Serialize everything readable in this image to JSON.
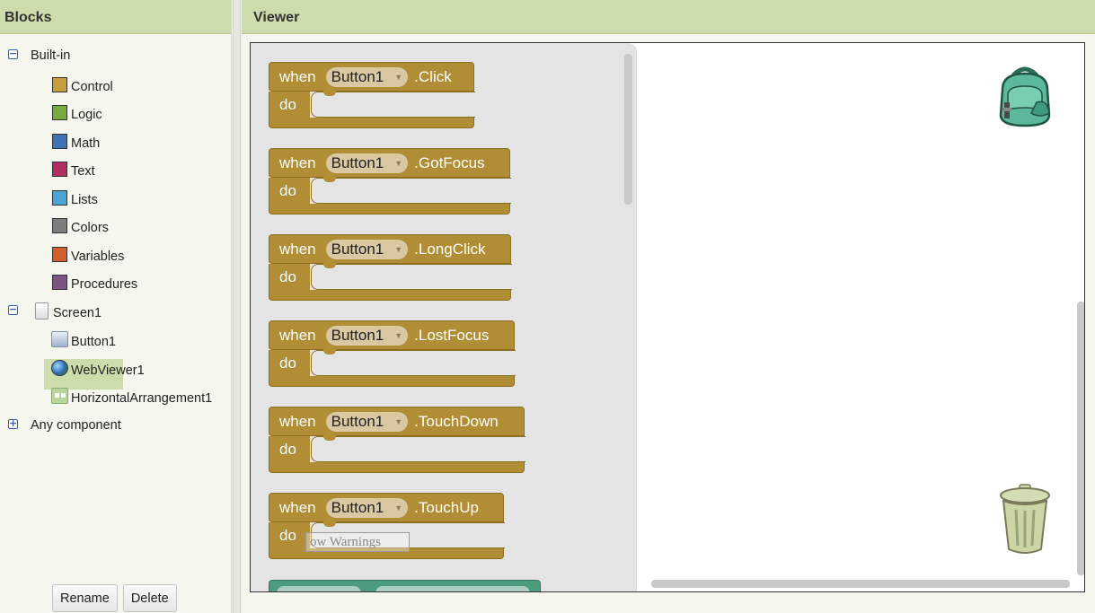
{
  "blocks_panel": {
    "title": "Blocks",
    "builtin_label": "Built-in",
    "builtin_items": [
      {
        "label": "Control",
        "color": "#c89f3d"
      },
      {
        "label": "Logic",
        "color": "#77ab41"
      },
      {
        "label": "Math",
        "color": "#3f71b5"
      },
      {
        "label": "Text",
        "color": "#b32d5e"
      },
      {
        "label": "Lists",
        "color": "#49a6d4"
      },
      {
        "label": "Colors",
        "color": "#7d7d7d"
      },
      {
        "label": "Variables",
        "color": "#d05f2d"
      },
      {
        "label": "Procedures",
        "color": "#7c5385"
      }
    ],
    "screen_label": "Screen1",
    "components": [
      {
        "label": "Button1",
        "icon": "button-icon"
      },
      {
        "label": "WebViewer1",
        "icon": "globe-icon"
      },
      {
        "label": "HorizontalArrangement1",
        "icon": "horizontal-arrangement-icon"
      }
    ],
    "any_component_label": "Any component",
    "rename_label": "Rename",
    "delete_label": "Delete"
  },
  "viewer": {
    "title": "Viewer",
    "event_blocks": [
      {
        "when": "when",
        "component": "Button1",
        "event": ".Click",
        "do": "do"
      },
      {
        "when": "when",
        "component": "Button1",
        "event": ".GotFocus",
        "do": "do"
      },
      {
        "when": "when",
        "component": "Button1",
        "event": ".LongClick",
        "do": "do"
      },
      {
        "when": "when",
        "component": "Button1",
        "event": ".LostFocus",
        "do": "do"
      },
      {
        "when": "when",
        "component": "Button1",
        "event": ".TouchDown",
        "do": "do"
      },
      {
        "when": "when",
        "component": "Button1",
        "event": ".TouchUp",
        "do": "do"
      }
    ],
    "warnings_label": "ow Warnings",
    "backpack_icon": "backpack-icon",
    "trash_icon": "trash-icon"
  },
  "colors": {
    "header_bg": "#cddcab",
    "event_block": "#b18e35",
    "property_block": "#4c9b7d"
  }
}
